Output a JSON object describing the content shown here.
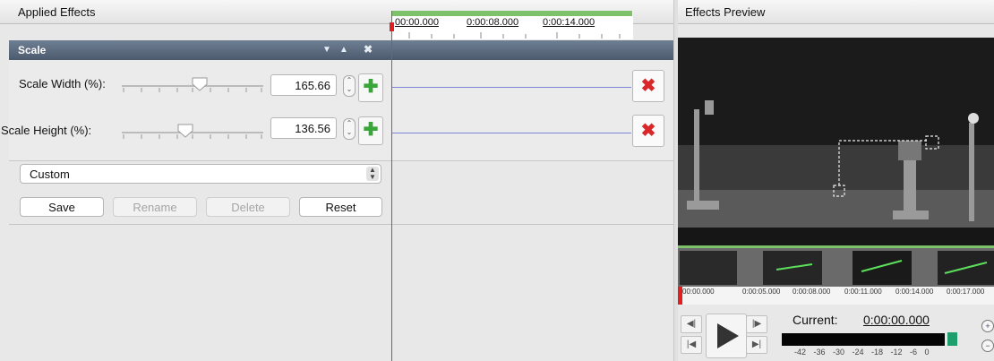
{
  "left_panel": {
    "title": "Applied Effects"
  },
  "timeline": {
    "ticks": [
      "00:00.000",
      "0:00:08.000",
      "0:00:14.000"
    ]
  },
  "effect": {
    "name": "Scale",
    "params": [
      {
        "label": "Scale Width (%):",
        "value": "165.66",
        "slider_fraction": 0.55
      },
      {
        "label": "Scale Height (%):",
        "value": "136.56",
        "slider_fraction": 0.45
      }
    ]
  },
  "presets": {
    "selected": "Custom",
    "buttons": {
      "save": "Save",
      "rename": "Rename",
      "delete": "Delete",
      "reset": "Reset"
    }
  },
  "right_panel": {
    "title": "Effects Preview"
  },
  "filmstrip": {
    "ticks": [
      "00:00.000",
      "0:00:05.000",
      "0:00:08.000",
      "0:00:11.000",
      "0:00:14.000",
      "0:00:17.000"
    ]
  },
  "transport": {
    "current_label": "Current:",
    "current_value": "0:00:00.000",
    "meter_scale": "-42 -36 -30 -24 -18 -12 -6 0"
  },
  "icons": {
    "collapse": "triangle-down-icon",
    "expand": "triangle-up-icon",
    "remove": "close-icon",
    "add_keyframe": "plus-icon",
    "delete_keyframe": "red-x-icon",
    "play": "play-icon",
    "zoom_in": "zoom-in-icon",
    "zoom_out": "zoom-out-icon"
  },
  "colors": {
    "accent_green": "#7dc16a",
    "playhead_red": "#ff2a2a",
    "header_blue": "#5a687c"
  }
}
